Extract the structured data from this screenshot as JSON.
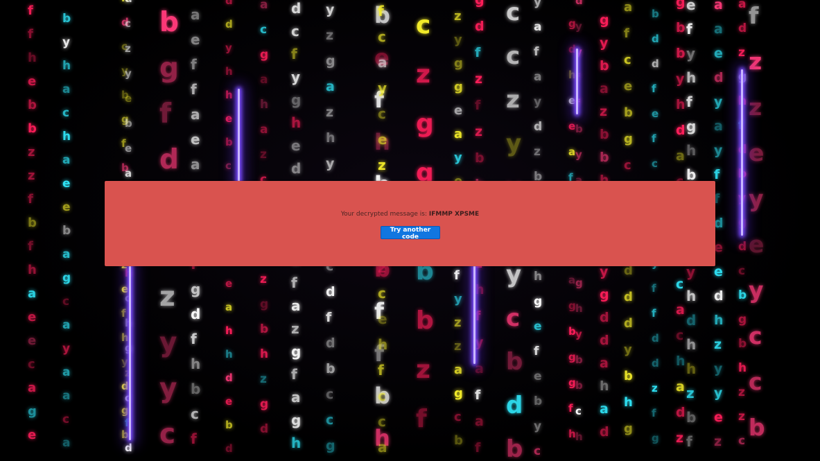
{
  "result": {
    "prefix": "Your decrypted message is:",
    "decoded_message": "IFMMP XPSME",
    "retry_label": "Try another code"
  },
  "background": {
    "style": "falling-letter matrix rain",
    "colors": [
      "#ff1e5a",
      "#2fe3f5",
      "#f5ee2a",
      "#ff3a7a",
      "#ffffff"
    ],
    "beam_color": "#7a4cff"
  }
}
